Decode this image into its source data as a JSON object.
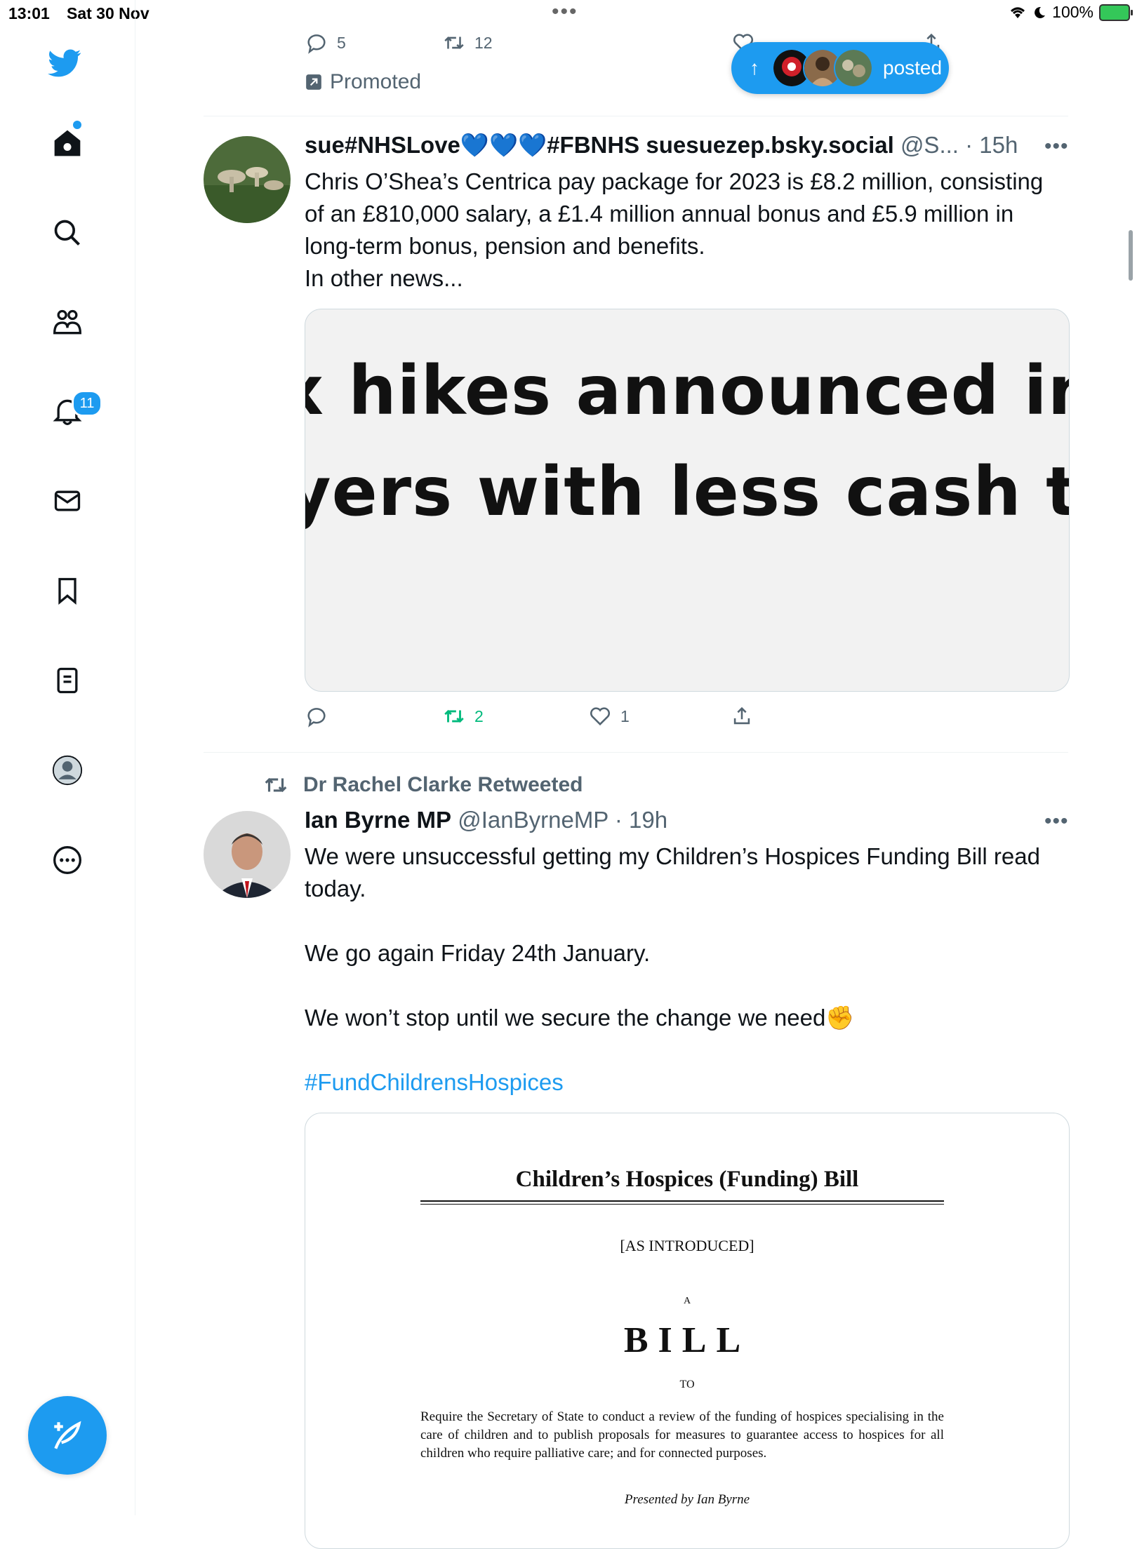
{
  "status_bar": {
    "time": "13:01",
    "date": "Sat 30 Nov",
    "battery": "100%"
  },
  "sidebar": {
    "items": [
      {
        "name": "twitter-logo"
      },
      {
        "name": "home"
      },
      {
        "name": "explore"
      },
      {
        "name": "communities"
      },
      {
        "name": "notifications",
        "badge": "11"
      },
      {
        "name": "messages"
      },
      {
        "name": "bookmarks"
      },
      {
        "name": "lists"
      },
      {
        "name": "profile"
      },
      {
        "name": "more"
      }
    ]
  },
  "top_tweet": {
    "replies": "5",
    "retweets": "12",
    "promoted_label": "Promoted"
  },
  "posted_pill": {
    "label": "posted"
  },
  "tweet1": {
    "name": "sue#NHSLove💙💙💙#FBNHS suesuezep.bsky.social",
    "handle": "@S...",
    "time": "· 15h",
    "text": "Chris O’Shea’s Centrica pay package for 2023 is £8.2 million, consisting of an £810,000 salary, a £1.4 million annual bonus and £5.9 million in long-term bonus, pension and benefits.\nIn other news...",
    "image_line1": "x hikes announced in t",
    "image_line2": "yers with less cash to",
    "retweets": "2",
    "likes": "1"
  },
  "tweet2": {
    "retweeted_by": "Dr Rachel Clarke Retweeted",
    "name": "Ian Byrne MP",
    "handle": "@IanByrneMP",
    "time": "· 19h",
    "text": "We were unsuccessful getting my Children’s Hospices Funding Bill read today.\n\nWe go again Friday 24th January.\n\nWe won’t stop until we secure the change we need✊",
    "hashtag": "#FundChildrensHospices",
    "doc": {
      "title": "Children’s Hospices (Funding) Bill",
      "subtitle": "[AS INTRODUCED]",
      "a": "A",
      "bill": "BILL",
      "to": "TO",
      "body": "Require the Secretary of State to conduct a review of the funding of hospices specialising in the care of children and to publish proposals for measures to guarantee access to hospices for all children who require palliative care; and for connected purposes.",
      "presented": "Presented by Ian Byrne"
    }
  },
  "colors": {
    "accent": "#1d9bf0",
    "retweet_green": "#00ba7c",
    "secondary_text": "#536471"
  }
}
